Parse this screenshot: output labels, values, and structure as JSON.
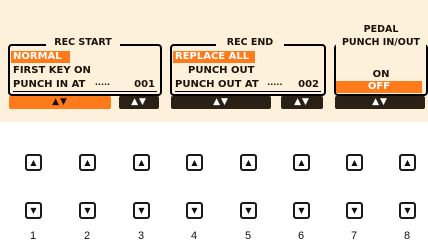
{
  "rec_start": {
    "title": "REC START",
    "options": [
      "NORMAL",
      "FIRST KEY ON"
    ],
    "punch_in_label": "PUNCH IN AT",
    "dots": "·····",
    "punch_in_value": "001",
    "arrows_left": "▲▼",
    "arrows_right": "▲▼"
  },
  "rec_end": {
    "title": "REC END",
    "options": [
      "REPLACE ALL",
      "PUNCH OUT"
    ],
    "punch_out_label": "PUNCH OUT AT",
    "dots": "·····",
    "punch_out_value": "002",
    "arrows_left": "▲▼",
    "arrows_right": "▲▼"
  },
  "pedal": {
    "title_line1": "PEDAL",
    "title_line2": "PUNCH IN/OUT",
    "options": [
      "ON",
      "OFF"
    ],
    "arrows": "▲▼"
  },
  "buttons": {
    "up_symbol": "▲",
    "down_symbol": "▼",
    "numbers": [
      "1",
      "2",
      "3",
      "4",
      "5",
      "6",
      "7",
      "8"
    ]
  },
  "colors": {
    "lcd_bg": "#fdf1db",
    "selection": "#ff7a1a",
    "pill_dark": "#2a2016"
  }
}
